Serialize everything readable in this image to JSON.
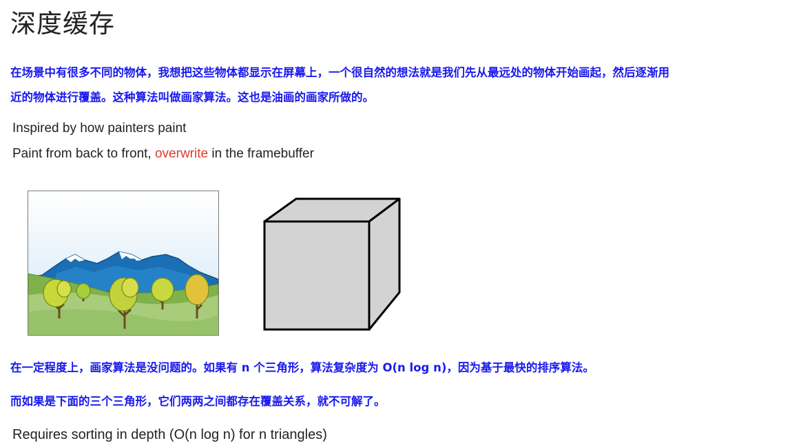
{
  "page": {
    "title": "深度缓存",
    "intro_line1": "在场景中有很多不同的物体，我想把这些物体都显示在屏幕上，一个很自然的想法就是我们先从最远处的物体开始画起，然后逐渐用",
    "intro_line2": "近的物体进行覆盖。这种算法叫做画家算法。这也是油画的画家所做的。",
    "inspired": "Inspired by how painters paint",
    "paint_prefix": "Paint from back to front, ",
    "paint_highlight": "overwrite",
    "paint_suffix": " in the framebuffer",
    "complexity_note": "在一定程度上，画家算法是没问题的。如果有 n 个三角形，算法复杂度为 O(n log n)，因为基于最快的排序算法。",
    "overlap_note": "而如果是下面的三个三角形，它们两两之间都存在覆盖关系，就不可解了。",
    "requires": "Requires sorting in depth (O(n log n) for n triangles)"
  },
  "colors": {
    "blue_text": "#1a1aee",
    "highlight": "#e03a2e",
    "cube_face": "#d3d3d3"
  }
}
